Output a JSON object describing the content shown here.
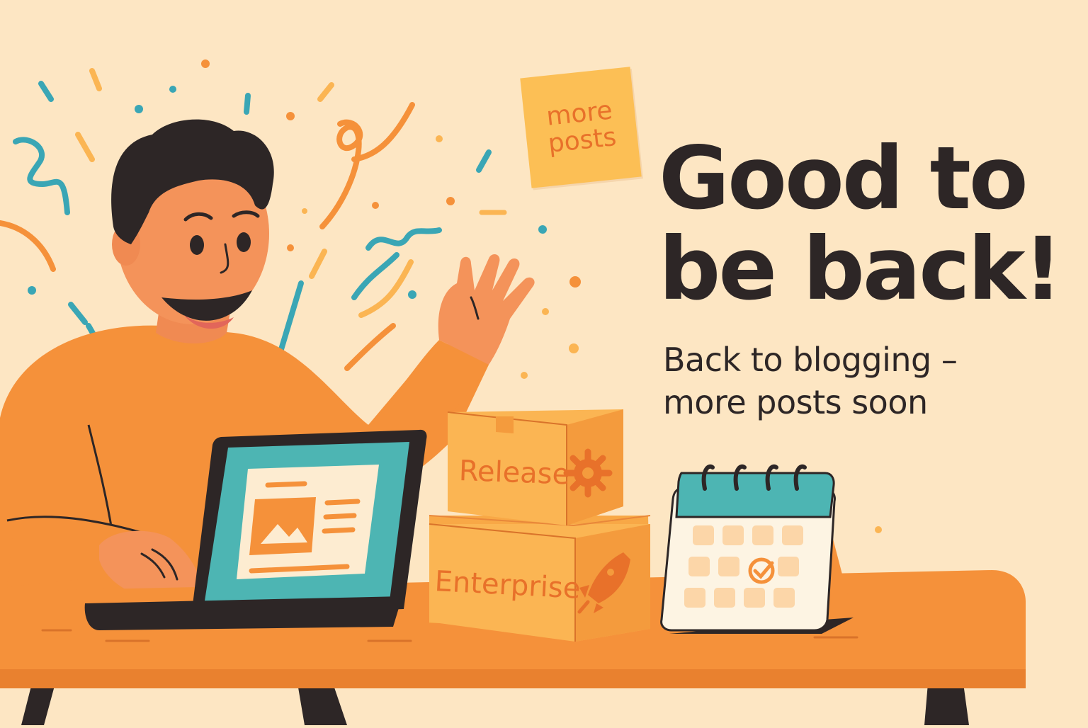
{
  "headline": {
    "line1": "Good to",
    "line2": "be back!"
  },
  "subline": {
    "line1": "Back to blogging –",
    "line2": "more posts soon"
  },
  "sticky_note": {
    "line1": "more",
    "line2": "posts"
  },
  "boxes": {
    "top_label": "Release",
    "bottom_label": "Enterprise"
  },
  "colors": {
    "background": "#fde6c3",
    "orange": "#f5913a",
    "teal": "#3aa6b5",
    "dark": "#2d2626",
    "box": "#fbb553"
  },
  "icons": [
    "gear-icon",
    "rocket-icon",
    "check-icon",
    "image-icon"
  ]
}
